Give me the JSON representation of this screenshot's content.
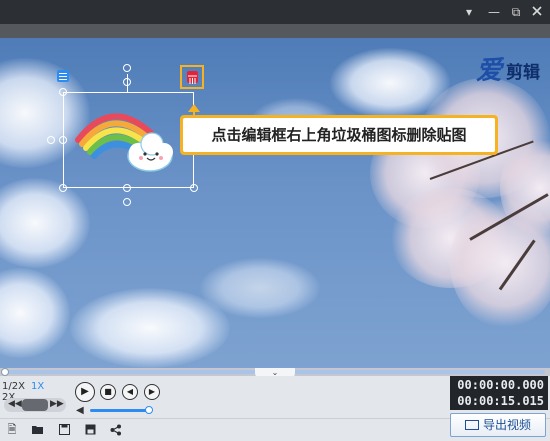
{
  "titlebar": {
    "dropdown_icon": "▾",
    "minimize_icon": "—",
    "restore_icon": "⧉"
  },
  "logo": {
    "text_main": "爱",
    "text_sub": "剪辑"
  },
  "tooltip": {
    "text": "点击编辑框右上角垃圾桶图标删除贴图"
  },
  "player": {
    "speeds": [
      "1/2X",
      "1X",
      "2X"
    ],
    "active_speed": "1X",
    "current_time": "00:00:00.000",
    "total_time": "00:00:15.015",
    "play_icon": "▶",
    "stop_icon": "■",
    "prev_icon": "◀",
    "next_icon": "▶",
    "collapse_icon": "⌄",
    "volume_icon": "◀"
  },
  "toolbar": {
    "export_label": "导出视频"
  },
  "colors": {
    "accent": "#2d8cf0",
    "tooltip_border": "#f5b324",
    "trash_red": "#e0253b"
  }
}
